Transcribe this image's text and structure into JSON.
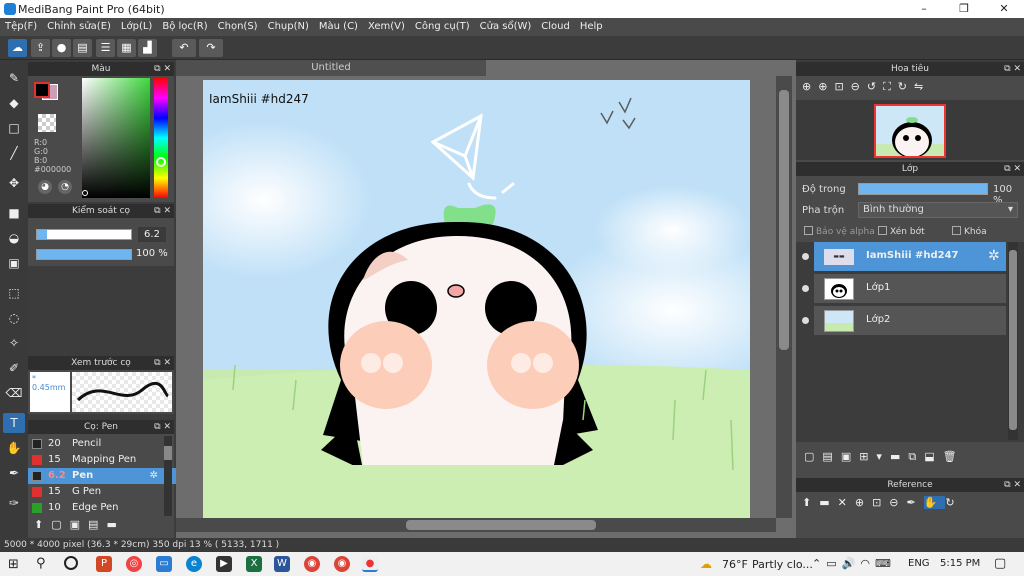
{
  "window": {
    "title": "MediBang Paint Pro (64bit)",
    "minimize": "–",
    "maximize": "❐",
    "close": "✕"
  },
  "menu": [
    "Tệp(F)",
    "Chỉnh sửa(E)",
    "Lớp(L)",
    "Bộ lọc(R)",
    "Chọn(S)",
    "Chụp(N)",
    "Màu (C)",
    "Xem(V)",
    "Công cụ(T)",
    "Cửa sổ(W)",
    "Cloud",
    "Help"
  ],
  "document": {
    "tab_title": "Untitled",
    "canvas_text": "IamShiii #hd247"
  },
  "color_panel": {
    "title": "Màu",
    "r": "R:0",
    "g": "G:0",
    "b": "B:0",
    "hex": "#000000",
    "primary_color": "#000000",
    "secondary_color": "#c9a0b8"
  },
  "brush_control": {
    "title": "Kiểm soát cọ",
    "size": "6.2",
    "opacity": "100 %",
    "opacity_value": 1.0
  },
  "brush_preview": {
    "title": "Xem trước cọ",
    "size": "0.45mm"
  },
  "brush_list": {
    "title": "Cọ: Pen",
    "items": [
      {
        "size": "20",
        "name": "Pencil",
        "color": "#222222"
      },
      {
        "size": "15",
        "name": "Mapping Pen",
        "color": "#e03030"
      },
      {
        "size": "6.2",
        "name": "Pen",
        "color": "#222222",
        "selected": true
      },
      {
        "size": "15",
        "name": "G Pen",
        "color": "#e03030"
      },
      {
        "size": "10",
        "name": "Edge Pen",
        "color": "#2aa02a"
      }
    ]
  },
  "navigator": {
    "title": "Hoa tiêu"
  },
  "layer_panel": {
    "title": "Lớp",
    "opacity_label": "Độ trong",
    "opacity_value": "100 %",
    "opacity_fraction": 1.0,
    "blend_label": "Pha trộn",
    "blend_value": "Bình thường",
    "protect_alpha": "Bảo vệ alpha",
    "clipping": "Xén bớt",
    "lock": "Khóa",
    "layers": [
      {
        "name": "IamShiii #hd247",
        "selected": true
      },
      {
        "name": "Lớp1"
      },
      {
        "name": "Lớp2"
      }
    ]
  },
  "reference": {
    "title": "Reference"
  },
  "status": {
    "text": "5000 * 4000 pixel  (36.3 * 29cm)  350 dpi  13 %  ( 5133, 1711 )"
  },
  "taskbar": {
    "weather_temp": "76°F",
    "weather_desc": "Partly clo...",
    "lang": "ENG",
    "time": "5:15 PM"
  }
}
